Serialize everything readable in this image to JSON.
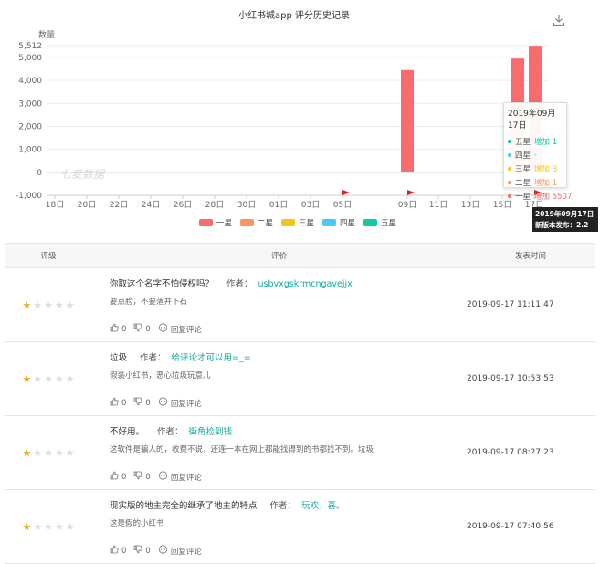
{
  "chart_data": {
    "type": "bar",
    "title": "小红书城app 评分历史记录",
    "ylabel": "数量",
    "ylim": [
      -1000,
      5512
    ],
    "yticks": [
      "5,512",
      "5,000",
      "4,000",
      "3,000",
      "2,000",
      "1,000",
      "0",
      "-1,000"
    ],
    "xticks": [
      "18日",
      "20日",
      "22日",
      "24日",
      "26日",
      "28日",
      "30日",
      "01日",
      "03日",
      "05日",
      "09日",
      "11日",
      "13日",
      "15日",
      "17日"
    ],
    "bars": [
      {
        "date": "09日",
        "series": "一星",
        "value": 4450
      },
      {
        "date": "15日",
        "series": "一星",
        "value": 4950
      },
      {
        "date": "17日",
        "series": "一星",
        "value": 5507
      }
    ],
    "series": [
      {
        "name": "一星",
        "color": "#f96b6e"
      },
      {
        "name": "二星",
        "color": "#f4985e"
      },
      {
        "name": "三星",
        "color": "#f5c517"
      },
      {
        "name": "四星",
        "color": "#4bc8f5"
      },
      {
        "name": "五星",
        "color": "#14c9a2"
      }
    ],
    "tooltip": {
      "title": "2019年09月17日",
      "rows": [
        {
          "label": "五星",
          "text": "增加 1",
          "color": "#14c9a2"
        },
        {
          "label": "四星",
          "text": "-",
          "color": "#4bc8f5"
        },
        {
          "label": "三星",
          "text": "增加 3",
          "color": "#f5c517"
        },
        {
          "label": "二星",
          "text": "增加 1",
          "color": "#f4985e"
        },
        {
          "label": "一星",
          "text": "增加 5507",
          "color": "#f96b6e"
        }
      ]
    },
    "flag_tip": [
      "2019年09月17日",
      "新版本发布：2.2"
    ],
    "watermark": "七麦数据"
  },
  "table": {
    "headers": {
      "rating": "评级",
      "review": "评价",
      "time": "发表时间"
    },
    "author_label": "作者：",
    "reply_label": "回复评论",
    "rows": [
      {
        "title": "你取这个名字不怕侵权吗？",
        "author": "usbvxgskrmcngavejjx",
        "body": "要点脸，不要落井下石",
        "likes": "0",
        "dislikes": "0",
        "time": "2019-09-17 11:11:47",
        "stars": 1
      },
      {
        "title": "垃圾",
        "author": "给评论才可以用=_=",
        "body": "假装小红书，恶心垃圾玩意儿",
        "likes": "0",
        "dislikes": "0",
        "time": "2019-09-17 10:53:53",
        "stars": 1
      },
      {
        "title": "不好用。",
        "author": "街角捡到钱",
        "body": "这软件是骗人的，收费不说，还连一本在网上都能找得到的书都找不到。垃圾",
        "likes": "0",
        "dislikes": "0",
        "time": "2019-09-17 08:27:23",
        "stars": 1
      },
      {
        "title": "现实版的地主完全的继承了地主的特点",
        "author": "玩欢，喜。",
        "body": "这是假的小红书",
        "likes": "0",
        "dislikes": "0",
        "time": "2019-09-17 07:40:56",
        "stars": 1
      }
    ]
  }
}
